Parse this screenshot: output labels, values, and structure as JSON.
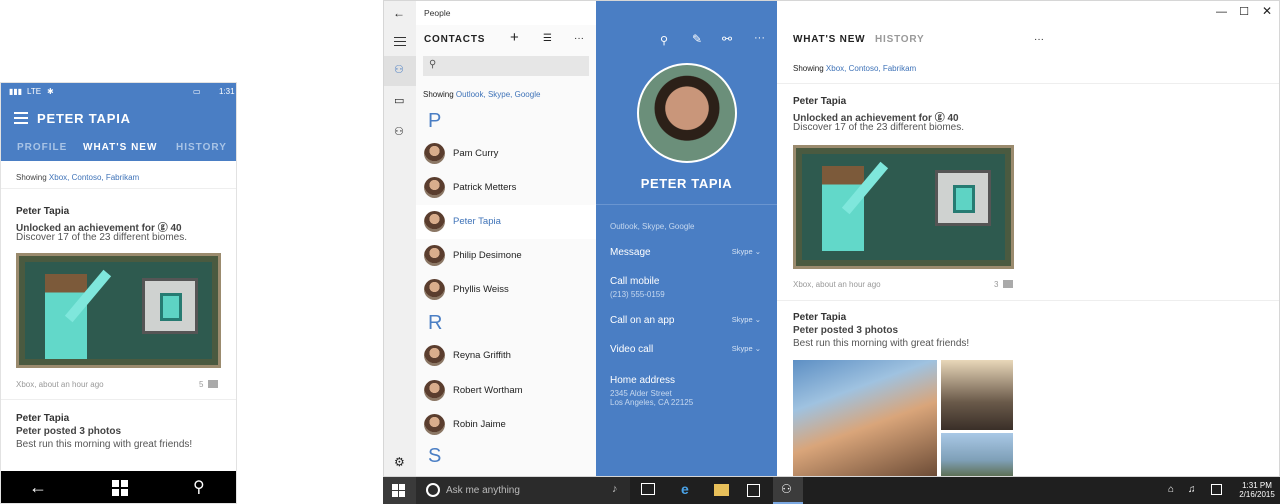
{
  "phone": {
    "status": {
      "signal": "LTE",
      "time": "1:31"
    },
    "title": "PETER TAPIA",
    "tabs": [
      "PROFILE",
      "WHAT'S NEW",
      "HISTORY"
    ],
    "showing_prefix": "Showing",
    "showing_sources": "Xbox, Contoso, Fabrikam",
    "posts": [
      {
        "name": "Peter Tapia",
        "line1": "Unlocked an achievement for ⓖ 40",
        "line2": "Discover 17 of the 23 different biomes.",
        "meta": "Xbox, about an hour ago",
        "count": "5"
      },
      {
        "name": "Peter Tapia",
        "line1": "Peter posted 3 photos",
        "line2": "Best run this morning with great friends!"
      }
    ]
  },
  "app": {
    "title": "People",
    "header": "CONTACTS",
    "showing_prefix": "Showing",
    "showing_sources": "Outlook, Skype, Google",
    "letters": [
      "P",
      "R",
      "S"
    ],
    "contacts_p": [
      "Pam Curry",
      "Patrick Metters",
      "Peter Tapia",
      "Philip Desimone",
      "Phyllis Weiss"
    ],
    "contacts_r": [
      "Reyna Griffith",
      "Robert Wortham",
      "Robin Jaime"
    ],
    "selected": "Peter Tapia"
  },
  "detail": {
    "name": "PETER TAPIA",
    "sources": "Outlook, Skype, Google",
    "items": [
      {
        "label": "Message",
        "service": "Skype"
      },
      {
        "label": "Call mobile",
        "sub": "(213) 555-0159"
      },
      {
        "label": "Call on an app",
        "service": "Skype"
      },
      {
        "label": "Video call",
        "service": "Skype"
      },
      {
        "label": "Home address",
        "sub": "2345 Alder Street",
        "sub2": "Los Angeles, CA 22125"
      }
    ]
  },
  "feed": {
    "tabs": [
      "WHAT'S NEW",
      "HISTORY"
    ],
    "showing_prefix": "Showing",
    "showing_sources": "Xbox, Contoso, Fabrikam",
    "posts": [
      {
        "name": "Peter Tapia",
        "line1": "Unlocked an achievement for ⓖ 40",
        "line2": "Discover 17 of the 23 different biomes.",
        "meta": "Xbox, about an hour ago",
        "count": "3"
      },
      {
        "name": "Peter Tapia",
        "line1": "Peter posted 3 photos",
        "line2": "Best run this morning with great friends!"
      }
    ]
  },
  "taskbar": {
    "search_placeholder": "Ask me anything",
    "time": "1:31 PM",
    "date": "2/16/2015"
  },
  "colors": {
    "accent": "#4a7ec4",
    "link": "#3f73b8",
    "taskbar": "#1f1f1f"
  }
}
